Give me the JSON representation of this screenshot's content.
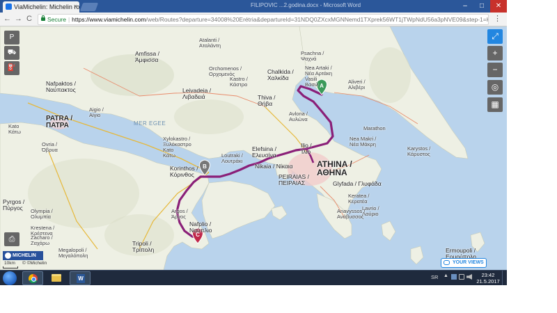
{
  "browser": {
    "tab_title": "ViaMichelin: Michelin ro",
    "tab_close": "×",
    "other_window_title": "FILIPOVIC ...2.godina.docx - Microsoft Word",
    "window_buttons": {
      "minimize": "–",
      "maximize": "□",
      "close": "✕"
    },
    "nav": {
      "back": "←",
      "forward": "→",
      "reload": "C"
    },
    "address": {
      "secure_label": "Secure",
      "separator": "|",
      "url_host": "https://www.viamichelin.com",
      "url_rest": "/web/Routes?departure=34008%20Erétria&departureId=31NDQ0ZXcxMGNNemd1TXprek56WT1jTWpNdU56a3pNVE09&step-1=Korinthos&step-1Id=31",
      "menu": "⋮"
    }
  },
  "map_tools": {
    "left": [
      "P",
      "⛟",
      "⛽"
    ],
    "print": "⎙",
    "right": {
      "fullscreen": "⤢",
      "zoom_in": "+",
      "zoom_out": "−",
      "locate": "◎",
      "layers": "▦"
    }
  },
  "map": {
    "markers": {
      "a": "A",
      "b": "B",
      "c": "C"
    },
    "places": {
      "psachna": [
        "Psachna /",
        "Ψαχνά"
      ],
      "nea_artaki": [
        "Nea Artaki /",
        "Νέα Αρτάκη",
        "Vasili",
        "Βασιλ"
      ],
      "chalkida": [
        "Chalkida /",
        "Χαλκίδα"
      ],
      "aliveri": [
        "Aliveri /",
        "Αλιβέρι"
      ],
      "atalanti": [
        "Atalanti /",
        "Αταλάντη"
      ],
      "amfissa": [
        "Amfissa /",
        "Άμφισσα"
      ],
      "orchomenos": [
        "Orchomenos /",
        "Ορχομενός"
      ],
      "kastro": [
        "Kastro /",
        "Κάστρο"
      ],
      "livadeia": [
        "Leivadeia /",
        "Λιβαδειά"
      ],
      "thiva": [
        "Thiva /",
        "Θήβα"
      ],
      "nafpaktos": [
        "Nafpaktos /",
        "Ναύπακτος"
      ],
      "aigio": [
        "Aigio /",
        "Αίγιο"
      ],
      "patra": [
        "PATRA /",
        "ΠΑΤΡΑ"
      ],
      "kato": [
        "Kato",
        "Κάτω"
      ],
      "ovria": [
        "Ovria /",
        "Όβρυα"
      ],
      "avlona": [
        "Avlona /",
        "Αυλώνα"
      ],
      "nea_makri": [
        "Nea Makri /",
        "Νέα Μάκρη"
      ],
      "marathon": [
        "Marathon"
      ],
      "karystos": [
        "Karystos /",
        "Κάρυστος"
      ],
      "xylokastro": [
        "Xylokastro /",
        "Ξυλόκαστρο",
        "Kato",
        "Κάτω"
      ],
      "loutraki": [
        "Loutraki /",
        "Λουτράκι"
      ],
      "elefsina": [
        "Elefsina /",
        "Ελευσίνα"
      ],
      "ilio": [
        "Ilio /",
        "Ίλιο"
      ],
      "athina": [
        "ATHINA /",
        "ΑΘΗΝΑ"
      ],
      "nikaia": [
        "Nikaia / Νίκαια"
      ],
      "peiraias": [
        "PEIRAIAS /",
        "ΠΕΙΡΑΙΑΣ"
      ],
      "glyfada": [
        "Glyfada / Γλυφάδα"
      ],
      "korinthos": [
        "Korinthos /",
        "Κόρινθος"
      ],
      "keratea": [
        "Keratea /",
        "Κερατέα"
      ],
      "lavrio": [
        "Lavrio /",
        "Λαύριο"
      ],
      "anavyssos": [
        "Anavyssos /",
        "Ανάβυσσος"
      ],
      "pyrgos": [
        "Pyrgos /",
        "Πύργος"
      ],
      "olympia": [
        "Olympia /",
        "Ολυμπία"
      ],
      "krestena": [
        "Krestena /",
        "Κρέστενα"
      ],
      "zacharo": [
        "Zacharo /",
        "Ζαχάρω"
      ],
      "argos": [
        "Argos /",
        "Άργος"
      ],
      "nafplio": [
        "Nafplio /",
        "Ναύπλιο"
      ],
      "tripoli": [
        "Tripoli /",
        "Τρίπολη"
      ],
      "megalopoli": [
        "Megalopoli /",
        "Μεγαλόπολη"
      ],
      "ermoupoli": [
        "Ermoupoli /",
        "Ερμούπολη"
      ],
      "mer_egee": [
        "MER EGEE"
      ],
      "gulf_label": [
        "MER EGEE"
      ]
    },
    "route_color": "#8a1f78",
    "sea_color": "#b9d3ec",
    "land_color": "#eef0e4"
  },
  "map_footer": {
    "brand": "MICHELIN",
    "scale": "10km",
    "copyright": "© ©Michelin",
    "your_views": "YOUR VIEWS"
  },
  "taskbar": {
    "word_icon": "W",
    "language": "SR",
    "tray_arrow": "▲",
    "time": "23:42",
    "date": "21.5.2017"
  }
}
